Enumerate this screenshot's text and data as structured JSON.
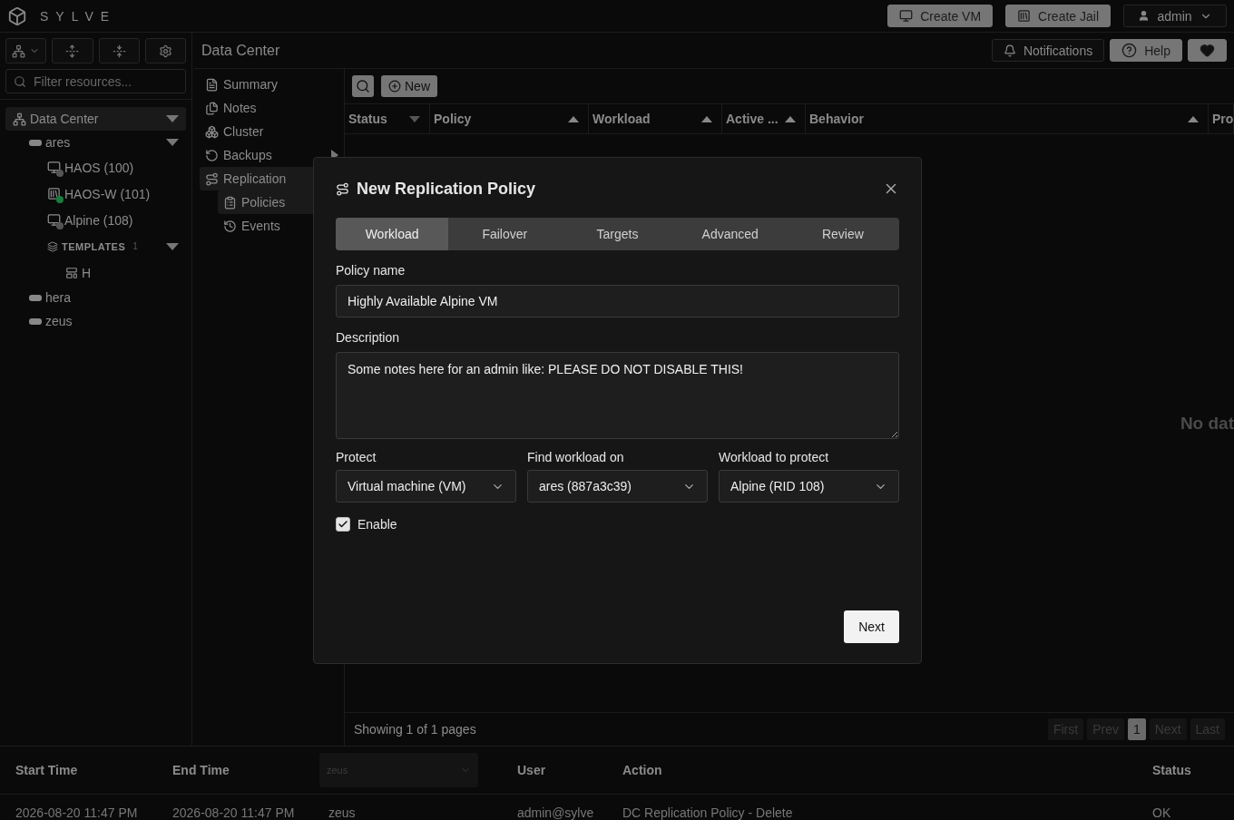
{
  "app": {
    "brand": "SYLVE"
  },
  "top_actions": [
    {
      "label": "Create VM",
      "kind": "vm"
    },
    {
      "label": "Create Jail",
      "kind": "jail"
    }
  ],
  "user_menu": {
    "label": "admin"
  },
  "sidebar": {
    "search": {
      "placeholder": "Filter resources..."
    },
    "tree": [
      {
        "label": "Data Center",
        "kind": "datacenter",
        "selected": true,
        "expanded": true,
        "children": [
          {
            "label": "ares",
            "kind": "node",
            "selected": false,
            "expanded": true,
            "children": [
              {
                "label": "HAOS (100)",
                "kind": "vm",
                "selected": false,
                "color": "#555555"
              },
              {
                "label": "HAOS-W (101)",
                "kind": "jail",
                "selected": false,
                "color": "#15803d"
              },
              {
                "label": "Alpine (108)",
                "kind": "vm",
                "selected": false,
                "color": "#555555"
              },
              {
                "label": "TEMPLATES",
                "count": "1",
                "kind": "group",
                "selected": false,
                "expanded": true,
                "children": [
                  {
                    "label": "H",
                    "kind": "template",
                    "selected": false
                  }
                ]
              }
            ]
          },
          {
            "label": "hera",
            "kind": "node",
            "selected": false
          },
          {
            "label": "zeus",
            "kind": "node",
            "selected": false
          }
        ]
      }
    ]
  },
  "header": {
    "title": "Data Center",
    "buttons": [
      {
        "label": "Notifications",
        "kind": "bell"
      },
      {
        "label": "Help",
        "kind": "help"
      },
      {
        "kind": "heart"
      }
    ]
  },
  "nav": [
    {
      "label": "Summary",
      "kind": "summary",
      "selected": false
    },
    {
      "label": "Notes",
      "kind": "notes",
      "selected": false
    },
    {
      "label": "Cluster",
      "kind": "cluster",
      "selected": false
    },
    {
      "label": "Backups",
      "kind": "backups",
      "selected": false,
      "submenu": true
    },
    {
      "label": "Replication",
      "kind": "replication",
      "selected": true,
      "children": [
        {
          "label": "Policies",
          "kind": "policies",
          "selected": true
        },
        {
          "label": "Events",
          "kind": "events",
          "selected": false
        }
      ]
    }
  ],
  "toolbar": {
    "new_label": "New"
  },
  "table": {
    "columns": [
      {
        "label": "Status",
        "ascending": false
      },
      {
        "label": "Policy",
        "ascending": true
      },
      {
        "label": "Workload",
        "ascending": true
      },
      {
        "label": "Active ...",
        "ascending": true
      },
      {
        "label": "Behavior",
        "ascending": true
      },
      {
        "label": "Pro"
      }
    ],
    "empty": "No dat",
    "footer": "Showing 1 of 1 pages",
    "pagination": [
      {
        "label": "First",
        "selected": false
      },
      {
        "label": "Prev",
        "selected": false
      },
      {
        "label": "1",
        "selected": true
      },
      {
        "label": "Next",
        "selected": false
      },
      {
        "label": "Last",
        "selected": false
      }
    ]
  },
  "events": {
    "columns": [
      {
        "label": "Start Time",
        "kind": "text"
      },
      {
        "label": "End Time",
        "kind": "text"
      },
      {
        "label": "zeus",
        "kind": "select"
      },
      {
        "label": "User",
        "kind": "text"
      },
      {
        "label": "Action",
        "kind": "text"
      },
      {
        "label": "Status",
        "kind": "text"
      }
    ],
    "rows": [
      [
        "2026-08-20 11:47 PM",
        "2026-08-20 11:47 PM",
        "zeus",
        "admin@sylve",
        "DC Replication Policy - Delete",
        "OK"
      ]
    ]
  },
  "dialog": {
    "title": "New Replication Policy",
    "tabs": [
      {
        "label": "Workload",
        "selected": true
      },
      {
        "label": "Failover",
        "selected": false
      },
      {
        "label": "Targets",
        "selected": false
      },
      {
        "label": "Advanced",
        "selected": false
      },
      {
        "label": "Review",
        "selected": false
      }
    ],
    "policy_name": {
      "label": "Policy name",
      "value": "Highly Available Alpine VM"
    },
    "description": {
      "label": "Description",
      "value": "Some notes here for an admin like: PLEASE DO NOT DISABLE THIS!"
    },
    "selects": [
      {
        "label": "Protect",
        "value": "Virtual machine (VM)"
      },
      {
        "label": "Find workload on",
        "value": "ares (887a3c39)"
      },
      {
        "label": "Workload to protect",
        "value": "Alpine (RID 108)"
      }
    ],
    "enable": {
      "label": "Enable",
      "checked": true
    },
    "next_label": "Next"
  }
}
